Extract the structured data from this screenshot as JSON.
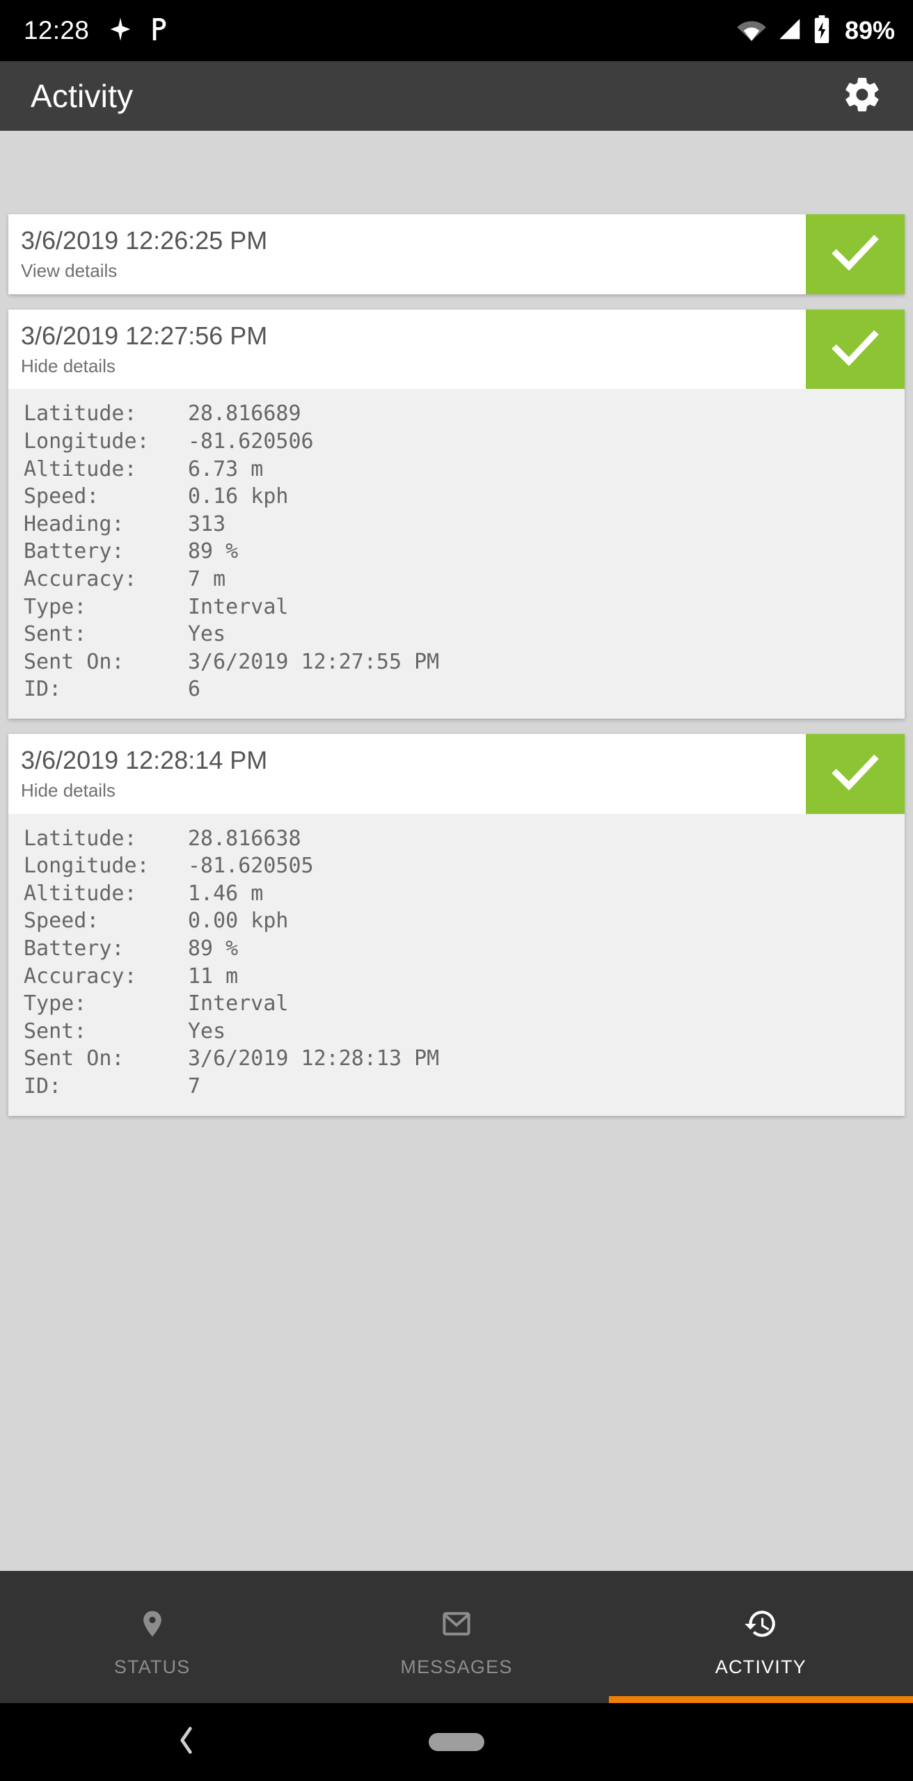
{
  "status_bar": {
    "time": "12:28",
    "battery_percent": "89%",
    "icons": [
      "sparkle-icon",
      "pushbullet-p-icon",
      "wifi-icon",
      "cell-signal-icon",
      "battery-charging-icon"
    ]
  },
  "app_bar": {
    "title": "Activity",
    "settings_icon": "gear-icon"
  },
  "colors": {
    "app_bar_bg": "#3e3e3e",
    "page_bg": "#d6d6d6",
    "card_bg": "#ffffff",
    "details_bg": "#f0f0f0",
    "status_green": "#8cc434",
    "accent_orange": "#ee8008",
    "bottom_nav_bg": "#333333"
  },
  "activity": {
    "cards": [
      {
        "timestamp": "3/6/2019 12:26:25 PM",
        "toggle_label": "View details",
        "status_icon": "check-icon",
        "expanded": false,
        "details": []
      },
      {
        "timestamp": "3/6/2019 12:27:56 PM",
        "toggle_label": "Hide details",
        "status_icon": "check-icon",
        "expanded": true,
        "details": [
          {
            "label": "Latitude:",
            "value": "28.816689"
          },
          {
            "label": "Longitude:",
            "value": "-81.620506"
          },
          {
            "label": "Altitude:",
            "value": "6.73 m"
          },
          {
            "label": "Speed:",
            "value": "0.16 kph"
          },
          {
            "label": "Heading:",
            "value": "313"
          },
          {
            "label": "Battery:",
            "value": "89 %"
          },
          {
            "label": "Accuracy:",
            "value": "7 m"
          },
          {
            "label": "Type:",
            "value": "Interval"
          },
          {
            "label": "Sent:",
            "value": "Yes"
          },
          {
            "label": "Sent On:",
            "value": "3/6/2019 12:27:55 PM"
          },
          {
            "label": "ID:",
            "value": "6"
          }
        ]
      },
      {
        "timestamp": "3/6/2019 12:28:14 PM",
        "toggle_label": "Hide details",
        "status_icon": "check-icon",
        "expanded": true,
        "details": [
          {
            "label": "Latitude:",
            "value": "28.816638"
          },
          {
            "label": "Longitude:",
            "value": "-81.620505"
          },
          {
            "label": "Altitude:",
            "value": "1.46 m"
          },
          {
            "label": "Speed:",
            "value": "0.00 kph"
          },
          {
            "label": "Battery:",
            "value": "89 %"
          },
          {
            "label": "Accuracy:",
            "value": "11 m"
          },
          {
            "label": "Type:",
            "value": "Interval"
          },
          {
            "label": "Sent:",
            "value": "Yes"
          },
          {
            "label": "Sent On:",
            "value": "3/6/2019 12:28:13 PM"
          },
          {
            "label": "ID:",
            "value": "7"
          }
        ]
      }
    ]
  },
  "bottom_nav": {
    "items": [
      {
        "label": "STATUS",
        "icon": "location-pin-icon",
        "active": false
      },
      {
        "label": "MESSAGES",
        "icon": "envelope-icon",
        "active": false
      },
      {
        "label": "ACTIVITY",
        "icon": "history-clock-icon",
        "active": true
      }
    ]
  },
  "system_nav": {
    "back_icon": "back-chevron-icon",
    "home_icon": "home-pill-icon"
  }
}
